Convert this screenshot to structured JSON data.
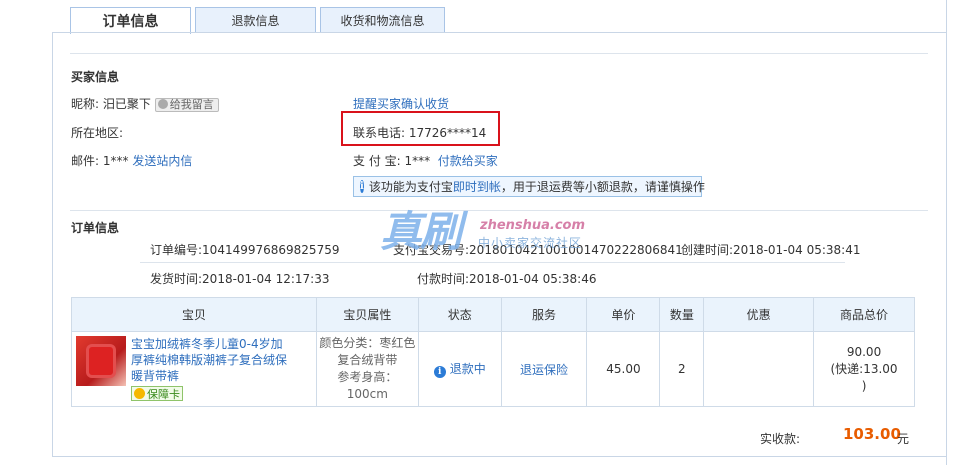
{
  "tabs": [
    "订单信息",
    "退款信息",
    "收货和物流信息"
  ],
  "buyer": {
    "section_title": "买家信息",
    "nickname_label": "昵称:",
    "nickname": "汨已聚下",
    "leave_msg": "给我留言",
    "region_label": "所在地区:",
    "email_label": "邮件:",
    "email_value": "1***",
    "send_inbox": "发送站内信",
    "remind_confirm": "提醒买家确认收货",
    "phone_label": "联系电话:",
    "phone_value": "17726****14",
    "alipay_label": "支 付 宝:",
    "alipay_value": "1***",
    "pay_buyer": "付款给买家",
    "notice_pre": "该功能为支付宝",
    "notice_link": "即时到帐",
    "notice_post": "，用于退运费等小额退款，请谨慎操作"
  },
  "order": {
    "section_title": "订单信息",
    "order_no_label": "订单编号:",
    "order_no": "104149976869825759",
    "alipay_trade_label": "支付宝交易号:",
    "alipay_trade_no": "2018010421001001470222806841",
    "created_label": "创建时间:",
    "created_time": "2018-01-04 05:38:41",
    "ship_label": "发货时间:",
    "ship_time": "2018-01-04 12:17:33",
    "pay_label": "付款时间:",
    "pay_time": "2018-01-04 05:38:46"
  },
  "watermark": {
    "big": "真刷",
    "en": "zhenshua.com",
    "cn": "中小卖家交流社区"
  },
  "table": {
    "headers": [
      "宝贝",
      "宝贝属性",
      "状态",
      "服务",
      "单价",
      "数量",
      "优惠",
      "商品总价"
    ],
    "row": {
      "title": "宝宝加绒裤冬季儿童0-4岁加厚裤纯棉韩版潮裤子复合绒保暖背带裤",
      "badge": "保障卡",
      "attr1": "颜色分类：枣红色",
      "attr2": "复合绒背带",
      "attr3": "参考身高：100cm",
      "status": "退款中",
      "service": "退运保险",
      "price": "45.00",
      "qty": "2",
      "discount": "",
      "total": "90.00",
      "shipping": "(快递:13.00",
      "shipping_close": ")"
    }
  },
  "summary": {
    "label": "实收款:",
    "amount": "103.00",
    "unit": "元"
  },
  "colors": {
    "link": "#2e6ebd",
    "highlight_box": "#d9121b",
    "amount": "#e85c00",
    "table_header_bg": "#eaf3fc"
  }
}
